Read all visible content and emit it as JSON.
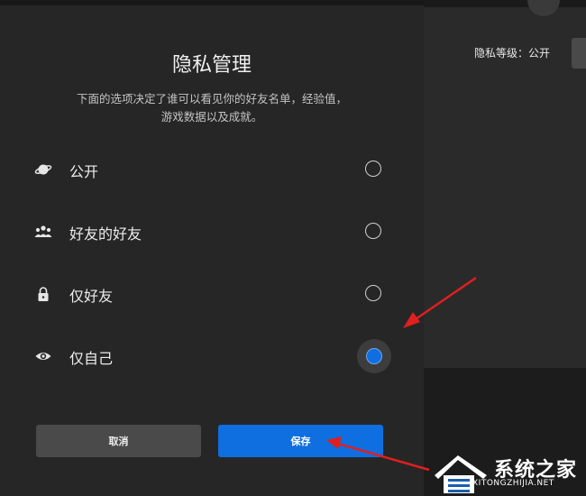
{
  "background": {
    "privacy_level_text": "隐私等级：公开"
  },
  "dialog": {
    "title": "隐私管理",
    "description": "下面的选项决定了谁可以看见你的好友名单，经验值，游戏数据以及成就。",
    "options": [
      {
        "label": "公开",
        "icon": "planet-icon",
        "selected": false
      },
      {
        "label": "好友的好友",
        "icon": "people-icon",
        "selected": false
      },
      {
        "label": "仅好友",
        "icon": "lock-icon",
        "selected": false
      },
      {
        "label": "仅自己",
        "icon": "eye-icon",
        "selected": true
      }
    ],
    "cancel_label": "取消",
    "save_label": "保存"
  },
  "colors": {
    "accent": "#0f6fe0",
    "annotation_arrow": "#e01f1f"
  },
  "watermark": {
    "title": "系统之家",
    "subtitle": "XITONGZHIJIA.NET"
  }
}
